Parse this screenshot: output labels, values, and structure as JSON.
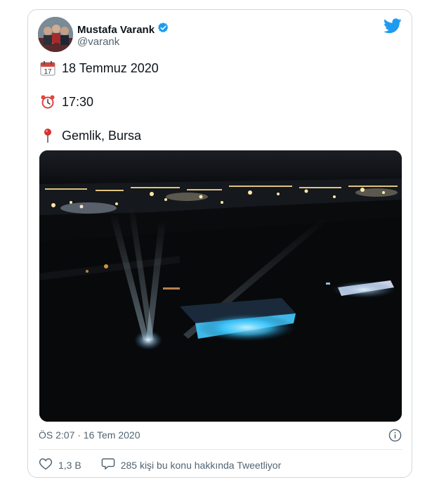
{
  "author": {
    "name": "Mustafa Varank",
    "handle": "@varank",
    "verified": true
  },
  "tweet": {
    "lines": [
      {
        "icon": "calendar-icon",
        "text": "18 Temmuz 2020"
      },
      {
        "icon": "alarm-clock-icon",
        "text": "17:30"
      },
      {
        "icon": "location-pin-icon",
        "text": "Gemlik, Bursa"
      }
    ],
    "timestamp": "ÖS 2:07 · 16 Tem 2020"
  },
  "calendar_glyph_day": "17",
  "engagement": {
    "likes": "1,3 B",
    "conversation": "285 kişi bu konu hakkında Tweetliyor"
  },
  "colors": {
    "twitter_blue": "#1d9bf0",
    "verified_blue": "#1d9bf0",
    "muted_text": "#536471",
    "border": "#cfd9de"
  }
}
